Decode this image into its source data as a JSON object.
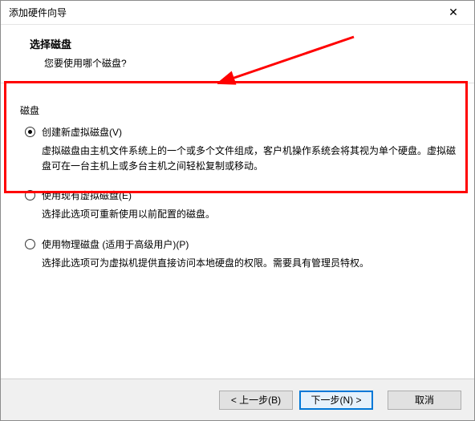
{
  "window": {
    "title": "添加硬件向导",
    "close_glyph": "✕"
  },
  "header": {
    "title": "选择磁盘",
    "subtitle": "您要使用哪个磁盘?"
  },
  "group": {
    "label": "磁盘"
  },
  "options": [
    {
      "label": "创建新虚拟磁盘(V)",
      "desc": "虚拟磁盘由主机文件系统上的一个或多个文件组成，客户机操作系统会将其视为单个硬盘。虚拟磁盘可在一台主机上或多台主机之间轻松复制或移动。",
      "checked": true
    },
    {
      "label": "使用现有虚拟磁盘(E)",
      "desc": "选择此选项可重新使用以前配置的磁盘。",
      "checked": false
    },
    {
      "label": "使用物理磁盘 (适用于高级用户)(P)",
      "desc": "选择此选项可为虚拟机提供直接访问本地硬盘的权限。需要具有管理员特权。",
      "checked": false
    }
  ],
  "footer": {
    "back": "< 上一步(B)",
    "next": "下一步(N) >",
    "cancel": "取消"
  },
  "annotation": {
    "color": "#ff0000"
  }
}
